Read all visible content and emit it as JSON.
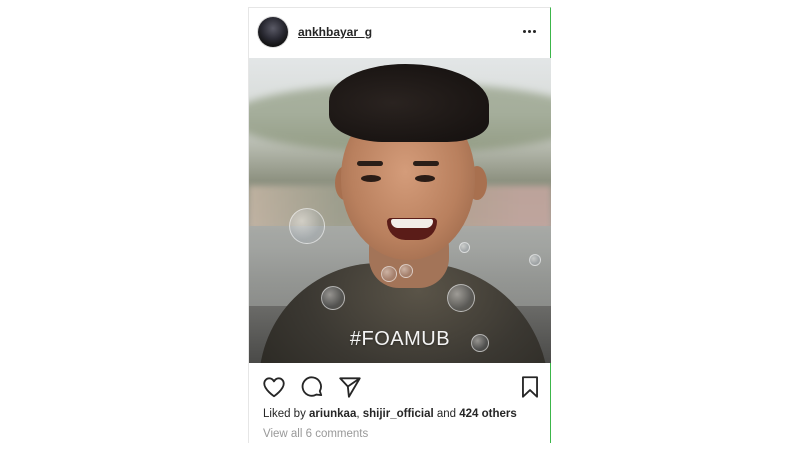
{
  "post": {
    "username": "ankhbayar_g",
    "photo_caption_overlay": "#FOAMUB",
    "likes": {
      "prefix": "Liked by ",
      "user1": "ariunkaa",
      "separator": ", ",
      "user2": "shijir_official",
      "middle": " and ",
      "others": "424 others"
    },
    "view_comments": "View all 6 comments"
  },
  "icons": {
    "more": "more-options-icon",
    "like": "heart-icon",
    "comment": "comment-icon",
    "share": "send-icon",
    "save": "bookmark-icon"
  },
  "colors": {
    "text": "#262626",
    "muted": "#999999",
    "border_accent": "#3cb64a"
  }
}
